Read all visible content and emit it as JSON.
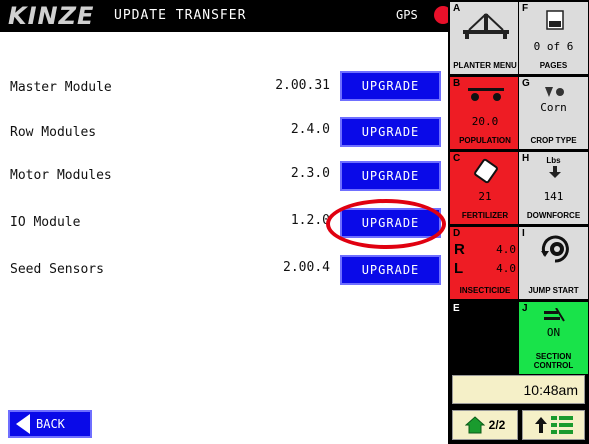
{
  "header": {
    "logo": "KINZE",
    "title": "UPDATE TRANSFER",
    "gps_label": "GPS"
  },
  "modules": [
    {
      "label": "Master Module",
      "version": "2.00.31",
      "button": "UPGRADE"
    },
    {
      "label": "Row Modules",
      "version": "2.4.0",
      "button": "UPGRADE"
    },
    {
      "label": "Motor Modules",
      "version": "2.3.0",
      "button": "UPGRADE"
    },
    {
      "label": "IO Module",
      "version": "1.2.0",
      "button": "UPGRADE"
    },
    {
      "label": "Seed Sensors",
      "version": "2.00.4",
      "button": "UPGRADE"
    }
  ],
  "back_button": "BACK",
  "side_panel": {
    "A": {
      "key": "A",
      "caption": "PLANTER MENU"
    },
    "F": {
      "key": "F",
      "value": "0 of 6",
      "caption": "PAGES"
    },
    "B": {
      "key": "B",
      "value": "20.0",
      "caption": "POPULATION"
    },
    "G": {
      "key": "G",
      "value": "Corn",
      "caption": "CROP TYPE"
    },
    "C": {
      "key": "C",
      "value": "21",
      "caption": "FERTILIZER"
    },
    "H": {
      "key": "H",
      "unit": "Lbs",
      "value": "141",
      "caption": "DOWNFORCE"
    },
    "D": {
      "key": "D",
      "r_label": "R",
      "r_value": "4.0",
      "l_label": "L",
      "l_value": "4.0",
      "caption": "INSECTICIDE"
    },
    "I": {
      "key": "I",
      "caption": "JUMP START"
    },
    "E": {
      "key": "E"
    },
    "J": {
      "key": "J",
      "value": "ON",
      "caption": "SECTION CONTROL"
    }
  },
  "clock": "10:48am",
  "page_indicator": "2/2",
  "colors": {
    "upgrade_blue": "#0a0ae8",
    "alert_red": "#ee1c24",
    "active_green": "#19e34a",
    "gray_tile": "#dcdcdc"
  }
}
